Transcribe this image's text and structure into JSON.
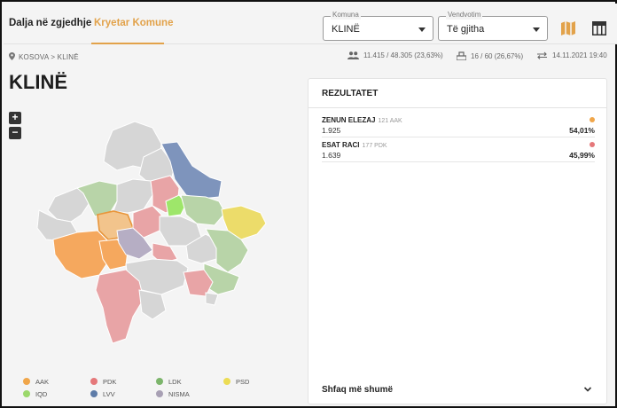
{
  "tabs": [
    {
      "label": "Dalja në zgjedhje"
    },
    {
      "label": "Kryetar Komune"
    }
  ],
  "filters": {
    "komuna": {
      "caption": "Komuna",
      "value": "KLINË"
    },
    "vendvotim": {
      "caption": "Vendvotim",
      "value": "Të gjitha"
    }
  },
  "breadcrumb": "KOSOVA > KLINË",
  "stats": {
    "turnout": "11.415 / 48.305 (23,63%)",
    "stations": "16 / 60 (26,67%)",
    "updated": "14.11.2021 19:40"
  },
  "page_title": "KLINË",
  "zoom": {
    "in": "+",
    "out": "−"
  },
  "results": {
    "title": "REZULTATET",
    "candidates": [
      {
        "name": "ZENUN ELEZAJ",
        "party_code": "121 AAK",
        "votes": "1.925",
        "percent": "54,01%",
        "color": "#f0a64a"
      },
      {
        "name": "ESAT RACI",
        "party_code": "177 PDK",
        "votes": "1.639",
        "percent": "45,99%",
        "color": "#e5787a"
      }
    ],
    "show_more": "Shfaq më shumë"
  },
  "legend": [
    {
      "label": "AAK",
      "color": "#f0a64a"
    },
    {
      "label": "PDK",
      "color": "#e5787a"
    },
    {
      "label": "LDK",
      "color": "#7cb56b"
    },
    {
      "label": "PSD",
      "color": "#ecdc54"
    },
    {
      "label": "IQD",
      "color": "#9bd86b"
    },
    {
      "label": "LVV",
      "color": "#5e7ca8"
    },
    {
      "label": "NISMA",
      "color": "#a8a0b4"
    }
  ],
  "map_colors": {
    "neutral": "#d6d6d6",
    "aak": "#f5a85e",
    "pdk": "#e8a4a6",
    "ldk": "#b8d4a8",
    "psd": "#ecdc6a",
    "iqd": "#9ee66a",
    "lvv": "#7e94bc",
    "nisma": "#b6aec4",
    "selected": "#f2c48c"
  }
}
